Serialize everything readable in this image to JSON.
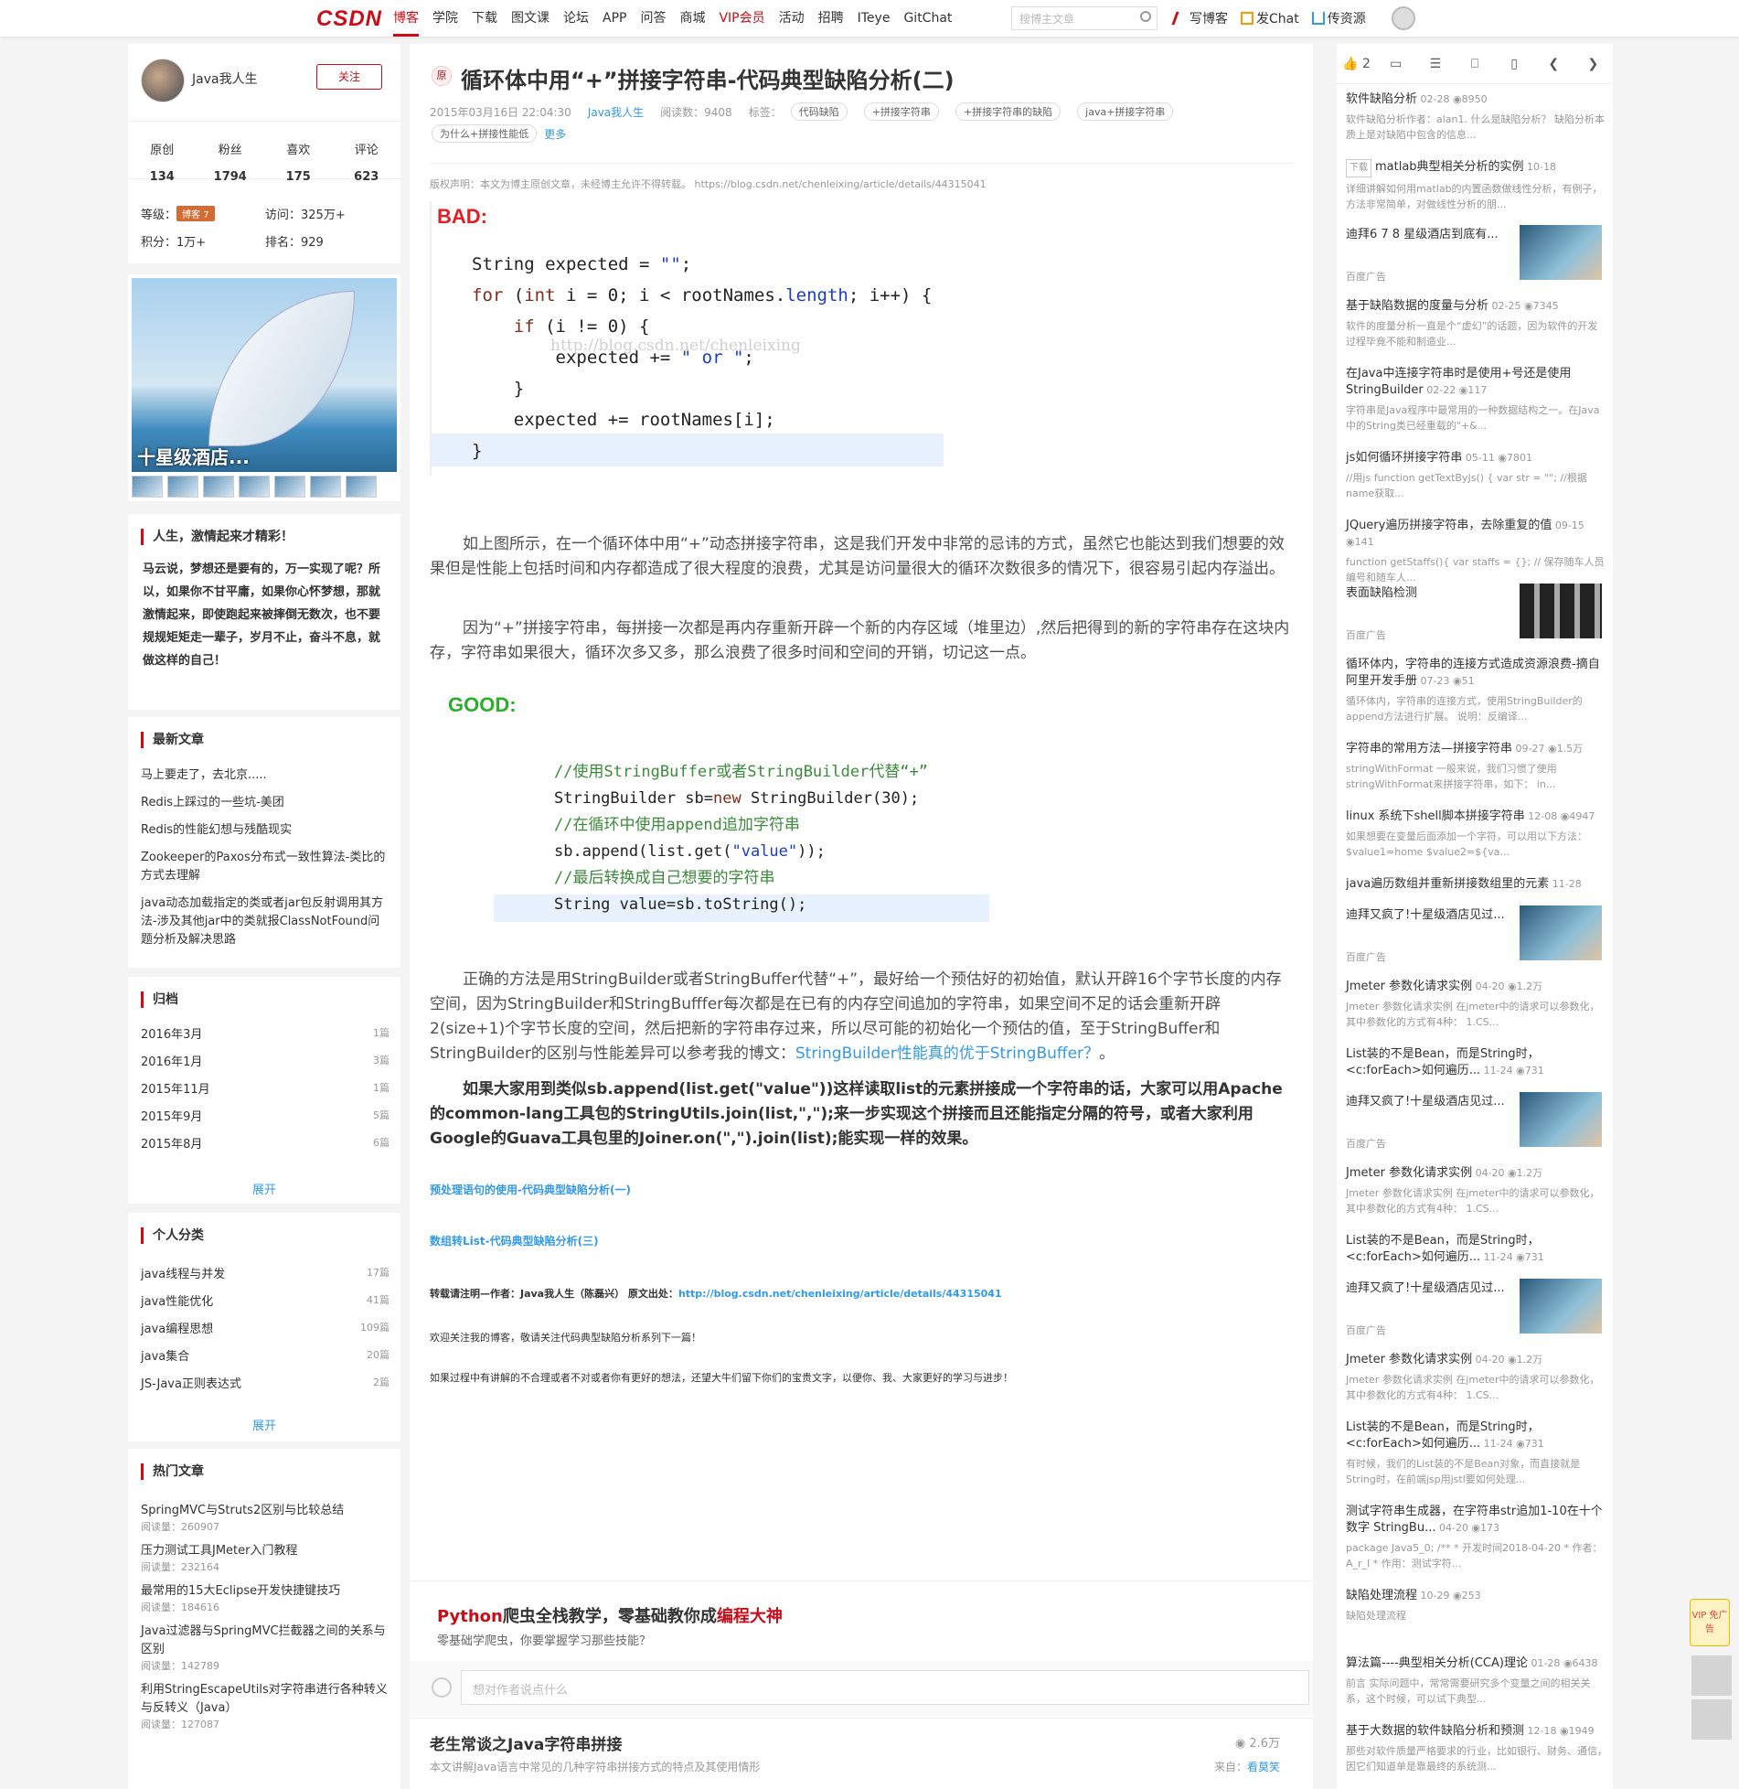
{
  "nav": {
    "logo": "CSDN",
    "items": [
      "博客",
      "学院",
      "下载",
      "图文课",
      "论坛",
      "APP",
      "问答",
      "商城",
      "VIP会员",
      "活动",
      "招聘",
      "ITeye",
      "GitChat"
    ],
    "search_placeholder": "搜博主文章",
    "right": [
      "写博客",
      "发Chat",
      "传资源"
    ]
  },
  "profile": {
    "name": "Java我人生",
    "follow": "关注",
    "stats": [
      {
        "label": "原创",
        "value": "134"
      },
      {
        "label": "粉丝",
        "value": "1794"
      },
      {
        "label": "喜欢",
        "value": "175"
      },
      {
        "label": "评论",
        "value": "623"
      }
    ],
    "level_label": "等级：",
    "level_badge": "博客 7",
    "visits_label": "访问：",
    "visits": "325万+",
    "points_label": "积分：",
    "points": "1万+",
    "rank_label": "排名：",
    "rank": "929"
  },
  "ad_left": {
    "caption": "十星级酒店..."
  },
  "motto": {
    "title": "人生，激情起来才精彩！",
    "text": "马云说，梦想还是要有的，万一实现了呢？所以，如果你不甘平庸，如果你心怀梦想，那就激情起来，即使跑起来被摔倒无数次，也不要规规矩矩走一辈子，岁月不止，奋斗不息，就做这样的自己！"
  },
  "latest": {
    "title": "最新文章",
    "items": [
      "马上要走了，去北京.....",
      "Redis上踩过的一些坑-美团",
      "Redis的性能幻想与残酷现实",
      "Zookeeper的Paxos分布式一致性算法-类比的方式去理解",
      "java动态加载指定的类或者jar包反射调用其方法-涉及其他jar中的类就报ClassNotFound问题分析及解决思路"
    ]
  },
  "archive": {
    "title": "归档",
    "items": [
      {
        "label": "2016年3月",
        "count": "1篇"
      },
      {
        "label": "2016年1月",
        "count": "3篇"
      },
      {
        "label": "2015年11月",
        "count": "1篇"
      },
      {
        "label": "2015年9月",
        "count": "5篇"
      },
      {
        "label": "2015年8月",
        "count": "6篇"
      }
    ],
    "expand": "展开"
  },
  "categories": {
    "title": "个人分类",
    "items": [
      {
        "label": "java线程与并发",
        "count": "17篇"
      },
      {
        "label": "java性能优化",
        "count": "41篇"
      },
      {
        "label": "java编程思想",
        "count": "109篇"
      },
      {
        "label": "java集合",
        "count": "20篇"
      },
      {
        "label": "JS-Java正则表达式",
        "count": "2篇"
      }
    ],
    "expand": "展开"
  },
  "hot": {
    "title": "热门文章",
    "items": [
      {
        "t": "SpringMVC与Struts2区别与比较总结",
        "r": "阅读量：260907"
      },
      {
        "t": "压力测试工具JMeter入门教程",
        "r": "阅读量：232164"
      },
      {
        "t": "最常用的15大Eclipse开发快捷键技巧",
        "r": "阅读量：184616"
      },
      {
        "t": "Java过滤器与SpringMVC拦截器之间的关系与区别",
        "r": "阅读量：142789"
      },
      {
        "t": "利用StringEscapeUtils对字符串进行各种转义与反转义（Java）",
        "r": "阅读量：127087"
      }
    ]
  },
  "article": {
    "orig": "原",
    "title": "循环体中用“+”拼接字符串-代码典型缺陷分析(二)",
    "date": "2015年03月16日 22:04:30",
    "author": "Java我人生",
    "reads": "阅读数：9408",
    "tags_label": "标签：",
    "tags": [
      "代码缺陷",
      "+拼接字符串",
      "+拼接字符串的缺陷",
      "java+拼接字符串",
      "为什么+拼接性能低"
    ],
    "more": "更多",
    "copyright": "版权声明：本文为博主原创文章，未经博主允许不得转载。 https://blog.csdn.net/chenleixing/article/details/44315041",
    "bad": "BAD:",
    "watermark": "http://blog.csdn.net/chenleixing",
    "p1": "如上图所示，在一个循环体中用“+”动态拼接字符串，这是我们开发中非常的忌讳的方式，虽然它也能达到我们想要的效果但是性能上包括时间和内存都造成了很大程度的浪费，尤其是访问量很大的循环次数很多的情况下，很容易引起内存溢出。",
    "p2": "因为“+”拼接字符串，每拼接一次都是再内存重新开辟一个新的内存区域（堆里边）,然后把得到的新的字符串存在这块内存，字符串如果很大，循环次多又多，那么浪费了很多时间和空间的开销，切记这一点。",
    "good": "GOOD:",
    "p3a": "正确的方法是用StringBuilder或者StringBuffer代替“+”，最好给一个预估好的初始值，默认开辟16个字节长度的内存空间，因为StringBuilder和StringBufffer每次都是在已有的内存空间追加的字符串，如果空间不足的话会重新开辟2(size+1)个字节长度的空间，然后把新的字符串存过来，所以尽可能的初始化一个预估的值，至于StringBuffer和StringBuilder的区别与性能差异可以参考我的博文：",
    "p3link": "StringBuilder性能真的优于StringBuffer？",
    "p3b": "。",
    "p4": "如果大家用到类似sb.append(list.get(\"value\"))这样读取list的元素拼接成一个字符串的话，大家可以用Apache的common-lang工具包的StringUtils.join(list,\",\");来一步实现这个拼接而且还能指定分隔的符号，或者大家利用Google的Guava工具包里的Joiner.on(\",\").join(list);能实现一样的效果。",
    "link1": "预处理语句的使用-代码典型缺陷分析(一)",
    "link2": "数组转List-代码典型缺陷分析(三)",
    "repost": "转载请注明—作者：Java我人生（陈磊兴）   原文出处：",
    "repost_url": "http://blog.csdn.net/chenleixing/article/details/44315041",
    "welcome": "欢迎关注我的博客，敬请关注代码典型缺陷分析系列下一篇！",
    "ending": "如果过程中有讲解的不合理或者不对或者你有更好的想法，还望大牛们留下你们的宝贵文字，以便你、我、大家更好的学习与进步！"
  },
  "ad_main": {
    "t1": "Python",
    "t2": "爬虫全栈教学，零基础教你成",
    "t3": "编程大神",
    "sub": "零基础学爬虫，你要掌握学习那些技能？"
  },
  "comment": {
    "placeholder": "想对作者说点什么"
  },
  "recommend": {
    "title": "老生常谈之Java字符串拼接",
    "views": "2.6万",
    "desc": "本文讲解Java语言中常见的几种字符串拼接方式的特点及其使用情形",
    "source_label": "来自：",
    "source": "看莫笑"
  },
  "right": {
    "likes": "2",
    "items": [
      {
        "t": "软件缺陷分析",
        "date": "02-28",
        "views": "8950",
        "d": "软件缺陷分析作者：alan1. 什么是缺陷分析？ 缺陷分析本质上是对缺陷中包含的信息..."
      },
      {
        "t": "matlab典型相关分析的实例",
        "date": "10-18",
        "badge": "下载",
        "d": "详细讲解如何用matlab的内置函数做线性分析，有例子，方法非常简单，对做线性分析的朋..."
      },
      {
        "t": "迪拜6 7 8 星级酒店到底有...",
        "ad": "百度广告"
      },
      {
        "t": "基于缺陷数据的度量与分析",
        "date": "02-25",
        "views": "7345",
        "d": "软件的度量分析一直是个“虚幻”的话题，因为软件的开发过程毕竟不能和制造业..."
      },
      {
        "t": "在Java中连接字符串时是使用+号还是使用StringBuilder",
        "date": "02-22",
        "views": "117",
        "d": "字符串是Java程序中最常用的一种数据结构之一。在Java中的String类已经重载的\"+&..."
      },
      {
        "t": "js如何循环拼接字符串",
        "date": "05-11",
        "views": "7801",
        "d": "//用js function getTextByJs() {  var str = \"\";  //根据name获取..."
      },
      {
        "t": "JQuery遍历拼接字符串，去除重复的值",
        "date": "09-15",
        "views": "141",
        "d": "function getStaffs(){ var staffs = {}; // 保存随车人员编号和随车人..."
      },
      {
        "t": "表面缺陷检测",
        "ad": "百度广告"
      },
      {
        "t": "循环体内，字符串的连接方式造成资源浪费-摘自阿里开发手册",
        "date": "07-23",
        "views": "51",
        "d": "循环体内，字符串的连接方式，使用StringBuilder的append方法进行扩展。 说明：反编译..."
      },
      {
        "t": "字符串的常用方法—拼接字符串",
        "date": "09-27",
        "views": "1.5万",
        "d": "stringWithFormat 一般来说，我们习惯了使用stringWithFormat来拼接字符串，如下： in..."
      },
      {
        "t": "linux 系统下shell脚本拼接字符串",
        "date": "12-08",
        "views": "4947",
        "d": "如果想要在变量后面添加一个字符，可以用以下方法： $value1=home $value2=${va..."
      },
      {
        "t": "java遍历数组并重新拼接数组里的元素",
        "date": "11-28"
      },
      {
        "t": "迪拜又疯了!十星级酒店见过...",
        "ad": "百度广告"
      },
      {
        "t": "Jmeter 参数化请求实例",
        "date": "04-20",
        "views": "1.2万",
        "d": "Jmeter 参数化请求实例 在jmeter中的请求可以参数化，其中参数化的方式有4种： 1.CS..."
      },
      {
        "t": "List装的不是Bean，而是String时，<c:forEach>如何遍历...",
        "date": "11-24",
        "views": "731"
      },
      {
        "t": "迪拜又疯了!十星级酒店见过...",
        "ad": "百度广告"
      },
      {
        "t": "Jmeter 参数化请求实例",
        "date": "04-20",
        "views": "1.2万",
        "d": "Jmeter 参数化请求实例 在jmeter中的请求可以参数化，其中参数化的方式有4种： 1.CS..."
      },
      {
        "t": "List装的不是Bean，而是String时，<c:forEach>如何遍历...",
        "date": "11-24",
        "views": "731"
      },
      {
        "t": "迪拜又疯了!十星级酒店见过...",
        "ad": "百度广告"
      },
      {
        "t": "Jmeter 参数化请求实例",
        "date": "04-20",
        "views": "1.2万",
        "d": "Jmeter 参数化请求实例 在jmeter中的请求可以参数化，其中参数化的方式有4种： 1.CS..."
      },
      {
        "t": "List装的不是Bean，而是String时，<c:forEach>如何遍历...",
        "date": "11-24",
        "views": "731",
        "d": "有时候，我们的List装的不是Bean对象，而直接就是String时，在前端jsp用jstl要如何处理..."
      },
      {
        "t": "测试字符串生成器，在字符串str追加1-10在十个数字 StringBu...",
        "date": "04-20",
        "views": "173",
        "d": "package Java5_0; /** * 开发时间2018-04-20 * 作者：A_r_I * 作用：测试字符..."
      },
      {
        "t": "缺陷处理流程",
        "date": "10-29",
        "views": "253",
        "d": "缺陷处理流程"
      },
      {
        "t": "算法篇----典型相关分析(CCA)理论",
        "date": "01-28",
        "views": "6438",
        "d": "前言   实际问题中，常常需要研究多个变量之间的相关关系，这个时候，可以试下典型..."
      },
      {
        "t": "基于大数据的软件缺陷分析和预测",
        "date": "12-18",
        "views": "1949",
        "d": "那些对软件质量严格要求的行业，比如银行、财务、通信，因它们知道单是靠最终的系统测..."
      }
    ]
  },
  "vip": "VIP 免广告"
}
